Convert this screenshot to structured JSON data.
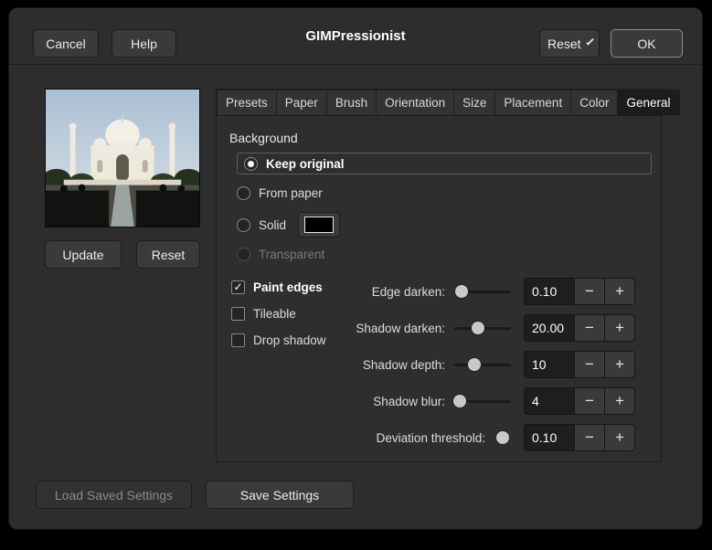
{
  "window": {
    "title": "GIMPressionist"
  },
  "header": {
    "cancel_label": "Cancel",
    "help_label": "Help",
    "reset_label": "Reset",
    "ok_label": "OK"
  },
  "preview": {
    "update_label": "Update",
    "reset_label": "Reset"
  },
  "tabs": [
    {
      "label": "Presets"
    },
    {
      "label": "Paper"
    },
    {
      "label": "Brush"
    },
    {
      "label": "Orientation"
    },
    {
      "label": "Size"
    },
    {
      "label": "Placement"
    },
    {
      "label": "Color"
    },
    {
      "label": "General",
      "active": true
    }
  ],
  "general": {
    "background_label": "Background",
    "radios": [
      {
        "label": "Keep original",
        "selected": true
      },
      {
        "label": "From paper",
        "selected": false
      },
      {
        "label": "Solid",
        "selected": false,
        "swatch_color": "#000000"
      },
      {
        "label": "Transparent",
        "selected": false,
        "disabled": true
      }
    ],
    "checkboxes": [
      {
        "label": "Paint edges",
        "checked": true
      },
      {
        "label": "Tileable",
        "checked": false
      },
      {
        "label": "Drop shadow",
        "checked": false
      }
    ],
    "params": [
      {
        "label": "Edge darken:",
        "value": "0.10",
        "slider_pos": 0.13
      },
      {
        "label": "Shadow darken:",
        "value": "20.00",
        "slider_pos": 0.42
      },
      {
        "label": "Shadow depth:",
        "value": "10",
        "slider_pos": 0.36
      },
      {
        "label": "Shadow blur:",
        "value": "4",
        "slider_pos": 0.1
      },
      {
        "label": "Deviation threshold:",
        "value": "0.10",
        "slider_pos": 0.5
      }
    ]
  },
  "footer": {
    "load_label": "Load Saved Settings",
    "save_label": "Save Settings"
  },
  "icons": {
    "minus": "−",
    "plus": "+",
    "check": "✓"
  }
}
